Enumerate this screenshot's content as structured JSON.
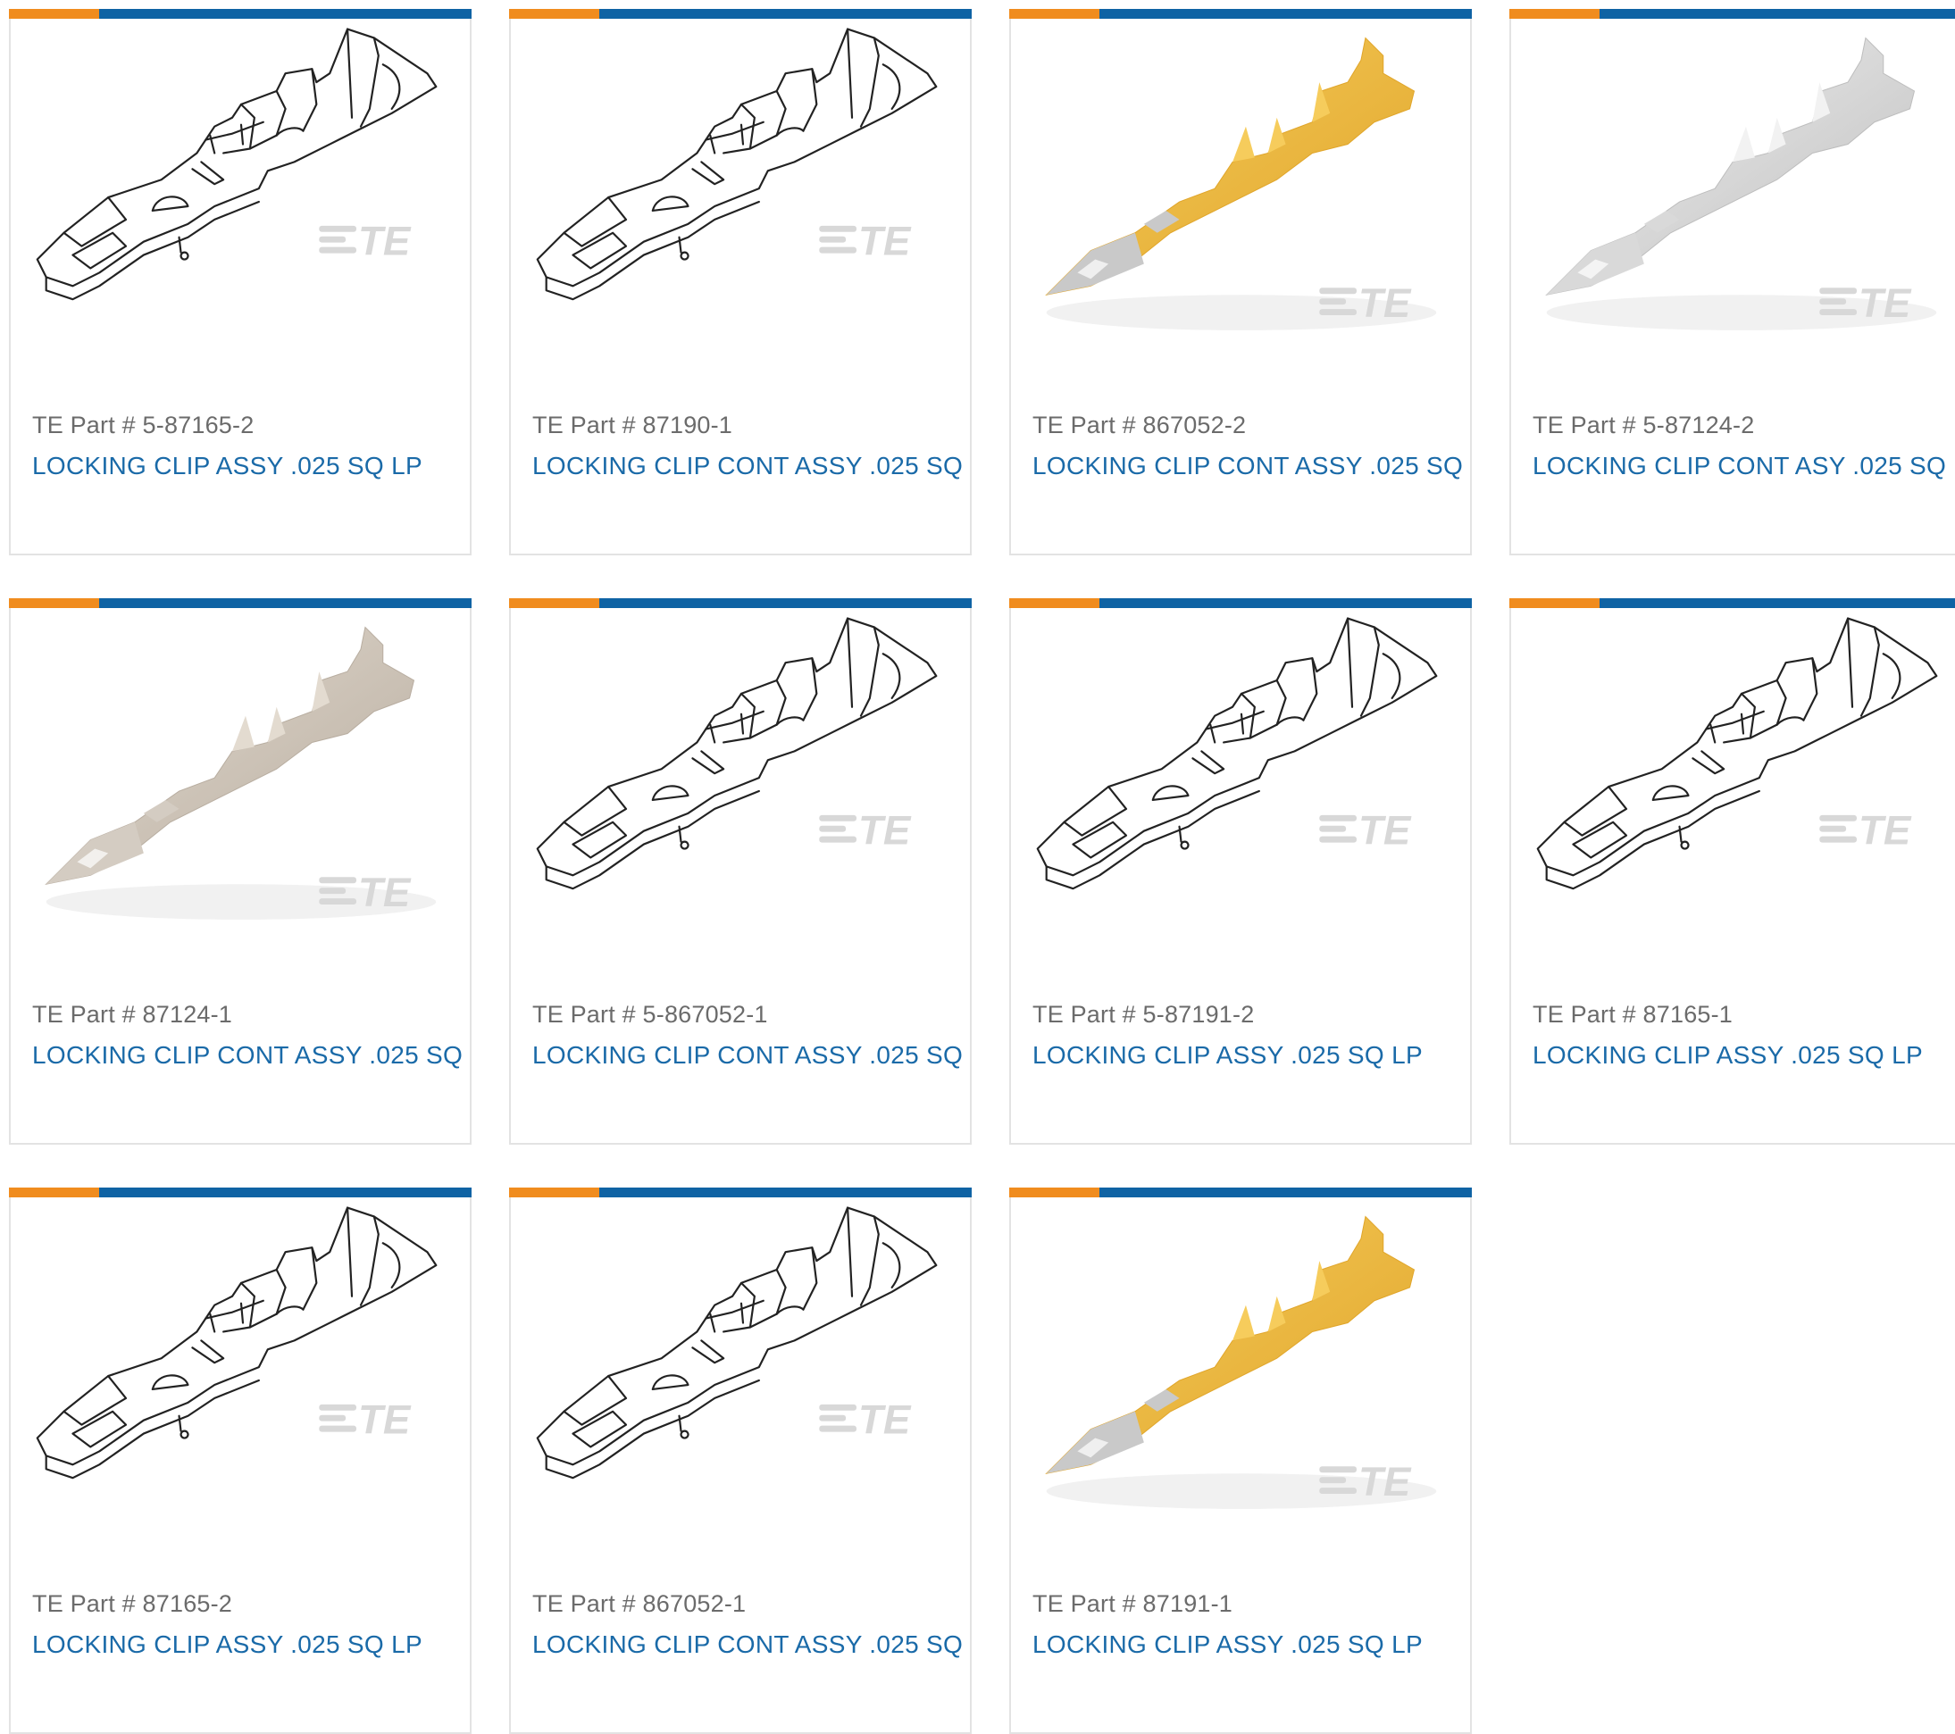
{
  "colors": {
    "accent_orange": "#f08c1e",
    "accent_blue": "#0f63a4",
    "part_text": "#6b6b6b",
    "desc_link": "#1a6aa8",
    "card_border": "#e3e3e3"
  },
  "logo_text": "TE",
  "products": [
    {
      "part": "TE Part # 5-87165-2",
      "desc": "LOCKING CLIP ASSY .025 SQ LP",
      "style": "line"
    },
    {
      "part": "TE Part # 87190-1",
      "desc": "LOCKING CLIP CONT ASSY .025 SQ",
      "style": "line"
    },
    {
      "part": "TE Part # 867052-2",
      "desc": "LOCKING CLIP CONT ASSY .025 SQ",
      "style": "gold"
    },
    {
      "part": "TE Part # 5-87124-2",
      "desc": "LOCKING CLIP CONT ASY .025 SQ",
      "style": "silver"
    },
    {
      "part": "TE Part # 87124-1",
      "desc": "LOCKING CLIP CONT ASSY .025 SQ",
      "style": "tin"
    },
    {
      "part": "TE Part # 5-867052-1",
      "desc": "LOCKING CLIP CONT ASSY .025 SQ",
      "style": "line"
    },
    {
      "part": "TE Part # 5-87191-2",
      "desc": "LOCKING CLIP ASSY .025 SQ LP",
      "style": "line"
    },
    {
      "part": "TE Part # 87165-1",
      "desc": "LOCKING CLIP ASSY .025 SQ LP",
      "style": "line"
    },
    {
      "part": "TE Part # 87165-2",
      "desc": "LOCKING CLIP ASSY .025 SQ LP",
      "style": "line"
    },
    {
      "part": "TE Part # 867052-1",
      "desc": "LOCKING CLIP CONT ASSY .025 SQ",
      "style": "line"
    },
    {
      "part": "TE Part # 87191-1",
      "desc": "LOCKING CLIP ASSY .025 SQ LP",
      "style": "gold"
    }
  ]
}
